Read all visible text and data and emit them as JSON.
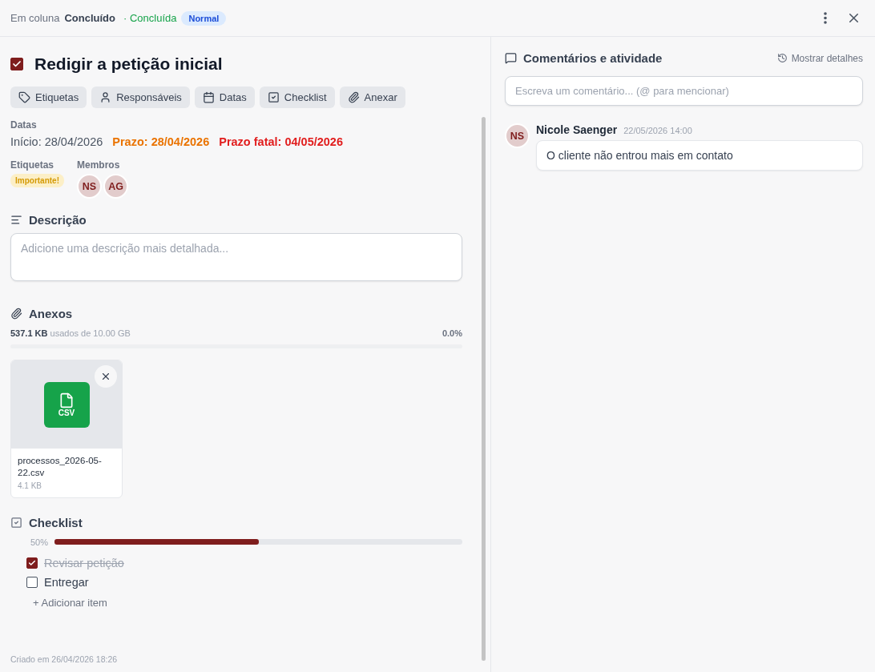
{
  "header": {
    "column_prefix": "Em coluna",
    "column": "Concluído",
    "status": "· Concluída",
    "priority": "Normal"
  },
  "task": {
    "title": "Redigir a petição inicial",
    "done": true
  },
  "actions": [
    {
      "label": "Etiquetas",
      "kind": "tag"
    },
    {
      "label": "Responsáveis",
      "kind": "user"
    },
    {
      "label": "Datas",
      "kind": "calendar"
    },
    {
      "label": "Checklist",
      "kind": "check"
    },
    {
      "label": "Anexar",
      "kind": "clip"
    }
  ],
  "dates": {
    "label": "Datas",
    "items": [
      {
        "text": "Início: 28/04/2026",
        "kind": "start"
      },
      {
        "text": "Prazo: 28/04/2026",
        "kind": "deadline"
      },
      {
        "text": "Prazo fatal: 04/05/2026",
        "kind": "fatal"
      }
    ]
  },
  "labels": {
    "label": "Etiquetas",
    "items": [
      "Importante!"
    ]
  },
  "members": {
    "label": "Membros",
    "items": [
      "NS",
      "AG"
    ]
  },
  "description": {
    "title": "Descrição",
    "placeholder": "Adicione uma descrição mais detalhada..."
  },
  "attachments": {
    "title": "Anexos",
    "used": "537.1 KB",
    "of": "usados de 10.00 GB",
    "percent": "0.0%",
    "level": 0.0,
    "files": [
      {
        "name": "processos_2026-05-22.csv",
        "size": "4.1 KB",
        "type": "CSV"
      }
    ]
  },
  "checklist": {
    "title": "Checklist",
    "percent": "50%",
    "level": 0.5,
    "items": [
      {
        "text": "Revisar petição",
        "checked": true
      },
      {
        "text": "Entregar",
        "checked": false
      }
    ],
    "add": "+ Adicionar item"
  },
  "created": "Criado em 26/04/2026 18:26",
  "comments": {
    "title": "Comentários e atividade",
    "details": "Mostrar detalhes",
    "placeholder": "Escreva um comentário... (@ para mencionar)",
    "items": [
      {
        "initials": "NS",
        "author": "Nicole Saenger",
        "time": "22/05/2026 14:00",
        "text": "O cliente não entrou mais em contato"
      }
    ]
  }
}
